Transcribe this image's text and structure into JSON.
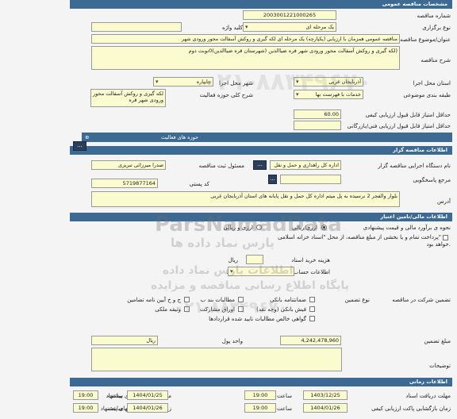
{
  "headers": {
    "general": "مشخصات مناقصه عمومی",
    "organizer": "اطلاعات مناقصه گزار",
    "financial": "اطلاعات مالی/تامین اعتبار",
    "timing": "اطلاعات زمانی"
  },
  "general": {
    "tender_number_label": "شماره مناقصه",
    "tender_number": "2003001221000265",
    "holding_type_label": "نوع برگزاری",
    "holding_type": "یک مرحله ای",
    "keyword_label": "کلید واژه",
    "title_label": "عنوان/موضوع مناقصه",
    "title": "مناقصه عمومی همزمان با ارزیابی (یکپارچه) یک مرحله ای لکه گیری و روکش آسفالت محور ورودی شهر",
    "description_label": "شرح مناقصه",
    "description": "لکه گیری و روکش آسفالت محور ورودی شهر قره ضیاالدین (شهرستان قره ضیاالدین)0نوبت دوم)",
    "province_label": "استان محل اجرا",
    "province": "آذربایجان غربی",
    "city_label": "شهر محل اجرا",
    "city": "چایپاره",
    "category_label": "طبقه بندی موضوعی",
    "category": "خدمات با فهرست بها",
    "scope_label": "شرح کلی حوزه فعالیت",
    "scope": "لکه گیری و روکش آسفالت محور ورودی شهر قره",
    "min_quality_label": "حداقل امتیاز قابل قبول ارزیابی کیفی",
    "min_quality": "60.00",
    "min_technical_label": "حداقل امتیاز قابل قبول ارزیابی فنی/بازرگانی",
    "activity_areas": "حوزه های فعالیت"
  },
  "organizer": {
    "device_label": "نام دستگاه اجرایی مناقصه گزار",
    "device": "اداره کل راهداری و حمل و نقل",
    "registrar_label": "مسئول ثبت مناقصه",
    "registrar": "صدرا میرزائی تبریزی",
    "reference_label": "مرجع پاسخگویی",
    "postal_label": "کد پستی",
    "postal": "5719877164",
    "address_label": "آدرس",
    "address": "بلوار والفجر 2 نرسیده به پل میثم اداره کل حمل و نقل پایانه های استان آذربایجان غربی",
    "more": "..."
  },
  "financial": {
    "estimate_label": "نحوه ی برآورد مالی و قیمت پیشنهادی",
    "estimate_value": "ارزی/ریالی",
    "estimate_value2": "ارزی و ریالی",
    "payment_text": "پرداخت تمام و یا بخشی از مبلغ مناقصه، از محل \"اسناد خزانه اسلامی\"",
    "payment_text2": "خواهد بود.",
    "doc_fee_label": "هزینه خرید اسناد",
    "doc_fee_unit": "ریال",
    "account_label": "اطلاعات حساب جهت واریز هزینه خرید اسناد",
    "guarantee_label": "نوع تضمین",
    "participation_label": "تضمین شرکت در مناقصه",
    "g_bank": "ضمانتنامه بانکی",
    "g_check": "فیش بانکی (وجه نقد)",
    "g_cert": "گواهی خالص مطالبات تایید شده قراردادها",
    "g_bond": "اوراق مشارکت",
    "g_article": "مطالبات بند ب",
    "g_insurance": "ج و خ آیین نامه تضامین",
    "g_property": "وثیقه ملکی",
    "amount_label": "مبلغ تضمین",
    "amount": "4,242,478,960",
    "currency_label": "واحد پول",
    "currency": "ریال",
    "notes_label": "توضیحات"
  },
  "timing": {
    "receive_docs_label": "مهلت دریافت اسناد",
    "receive_docs_date": "1403/12/25",
    "receive_docs_time": "19:00",
    "send_offer_label": "مهلت ارسال پاکتهای پیشنهاد",
    "send_offer_date": "1404/01/25",
    "send_offer_time": "19:00",
    "open_quality_label": "زمان بازگشایی پاکت ارزیابی کیفی",
    "open_quality_date": "1404/01/26",
    "open_quality_time": "19:00",
    "open_offer_label": "زمان بازگشایی پاکتهای پیشنهاد",
    "open_offer_date": "1404/01/26",
    "open_offer_time": "19:00",
    "time_label": "ساعت"
  },
  "watermark": {
    "brand": "ParsNamadData",
    "brand_fa": "پارس نماد داده ها",
    "slogan": "اطلاعات پارس نماد داده",
    "portal": "پایگاه اطلاع رسانی مناقصه و مزایده",
    "phone": "۰۲۱-۸۸۳۴۹۶۷۰",
    "phone2": "۰۲۱-۸۸۳۴۹۶۷۰"
  },
  "colors": {
    "header": "#3d6a93",
    "input": "#fbfbd0",
    "button": "#2c3f5a"
  }
}
